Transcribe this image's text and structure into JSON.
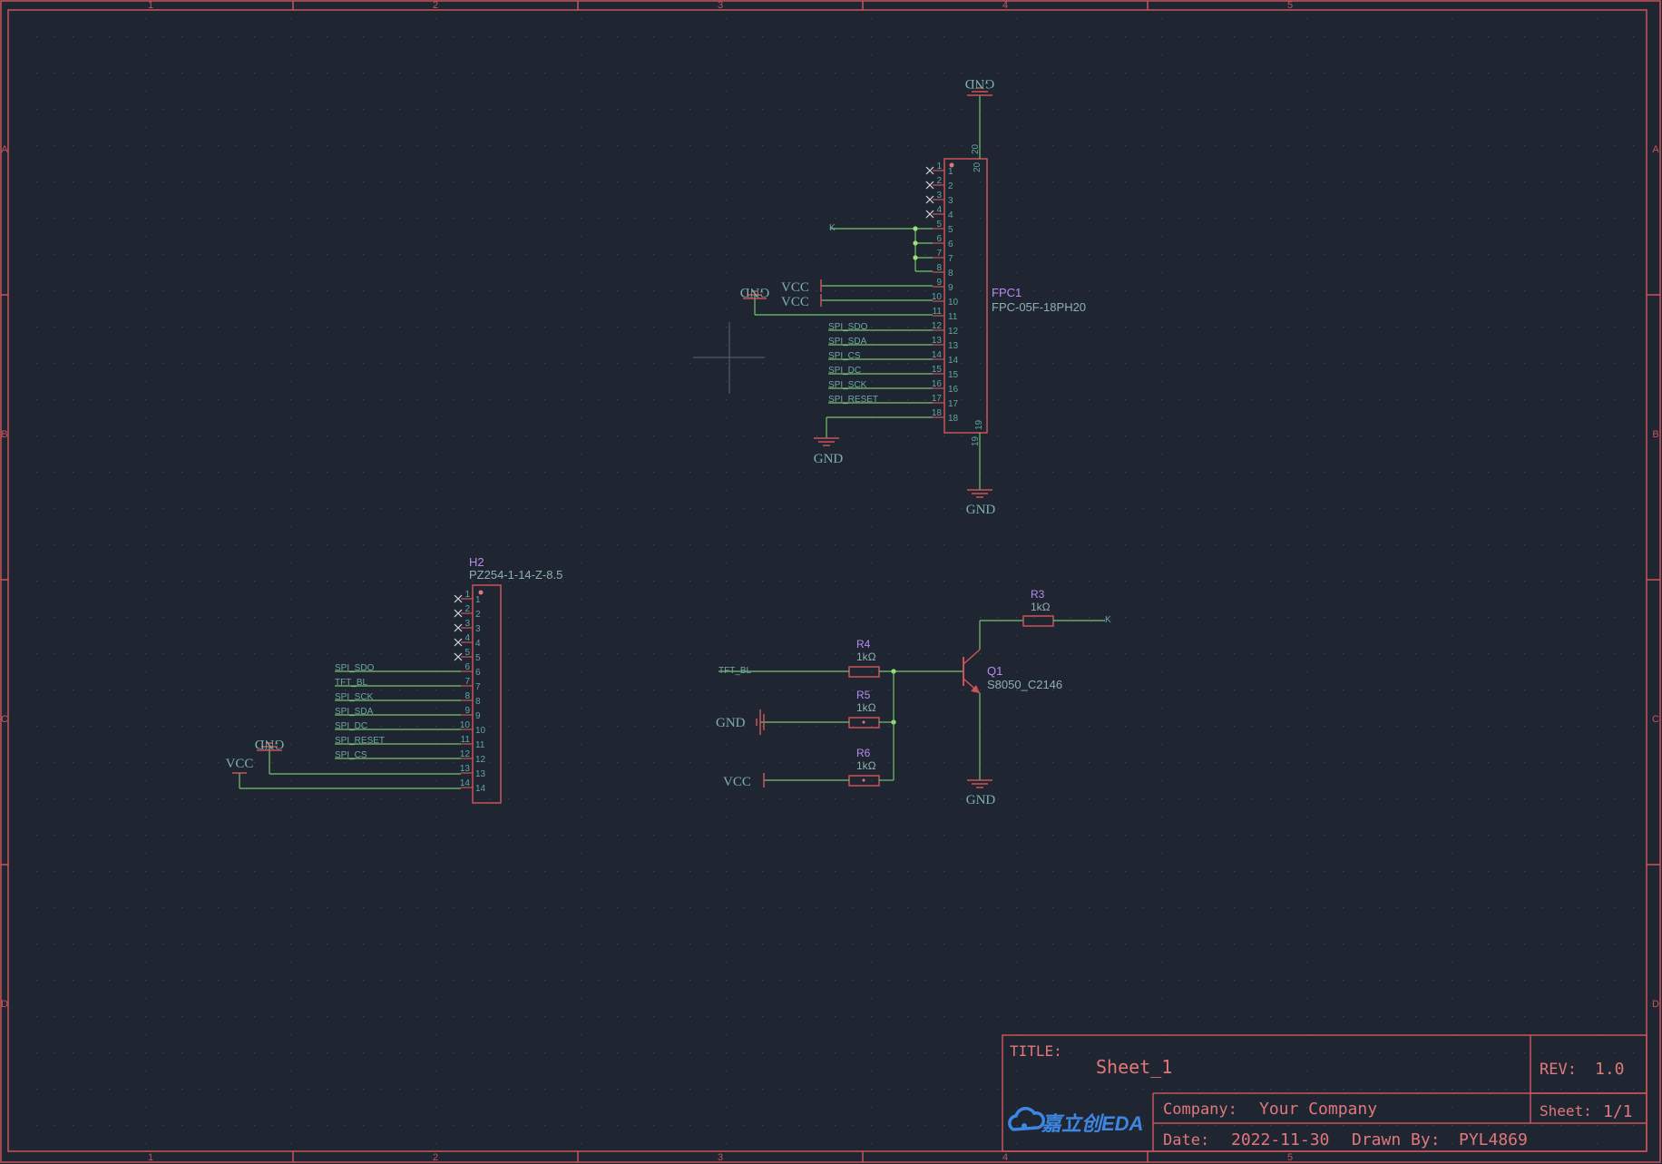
{
  "colors": {
    "background": "#1f2631",
    "border": "#c8555a",
    "wire": "#76c56f",
    "pin_name": "#5fa6a3",
    "part_label": "#b68cf0",
    "part_value": "#8fb0b0",
    "net_text": "#6fa5a8",
    "title_text": "#e0787c",
    "eda_blue": "#3d86e2",
    "grid_dot": "#3b4552"
  },
  "frame": {
    "columns": [
      "1",
      "2",
      "3",
      "4",
      "5"
    ],
    "rows": [
      "A",
      "B",
      "C",
      "D"
    ]
  },
  "title_block": {
    "title_label": "TITLE:",
    "title_value": "Sheet_1",
    "rev_label": "REV:",
    "rev_value": "1.0",
    "company_label": "Company:",
    "company_value": "Your Company",
    "sheet_label": "Sheet:",
    "sheet_value": "1/1",
    "date_label": "Date:",
    "date_value": "2022-11-30",
    "drawn_label": "Drawn By:",
    "drawn_value": "PYL4869",
    "logo_text": "嘉立创EDA"
  },
  "fpc1": {
    "designator": "FPC1",
    "value": "FPC-05F-18PH20",
    "pins": [
      "1",
      "2",
      "3",
      "4",
      "5",
      "6",
      "7",
      "8",
      "9",
      "10",
      "11",
      "12",
      "13",
      "14",
      "15",
      "16",
      "17",
      "18"
    ],
    "mount_top": "20",
    "mount_bottom": "19",
    "signal_nets": [
      "SPI_SDO",
      "SPI_SDA",
      "SPI_CS",
      "SPI_DC",
      "SPI_SCK",
      "SPI_RESET"
    ],
    "net_k": "K"
  },
  "h2": {
    "designator": "H2",
    "value": "PZ254-1-14-Z-8.5",
    "pins": [
      "1",
      "2",
      "3",
      "4",
      "5",
      "6",
      "7",
      "8",
      "9",
      "10",
      "11",
      "12",
      "13",
      "14"
    ],
    "signal_nets": [
      "SPI_SDO",
      "TFT_BL",
      "SPI_SCK",
      "SPI_SDA",
      "SPI_DC",
      "SPI_RESET",
      "SPI_CS"
    ]
  },
  "backlight": {
    "r3": {
      "designator": "R3",
      "value": "1kΩ"
    },
    "r4": {
      "designator": "R4",
      "value": "1kΩ"
    },
    "r5": {
      "designator": "R5",
      "value": "1kΩ"
    },
    "r6": {
      "designator": "R6",
      "value": "1kΩ"
    },
    "q1": {
      "designator": "Q1",
      "value": "S8050_C2146"
    },
    "net_tft_bl": "TFT_BL",
    "net_k": "K"
  },
  "power": {
    "gnd": "GND",
    "vcc": "VCC"
  }
}
